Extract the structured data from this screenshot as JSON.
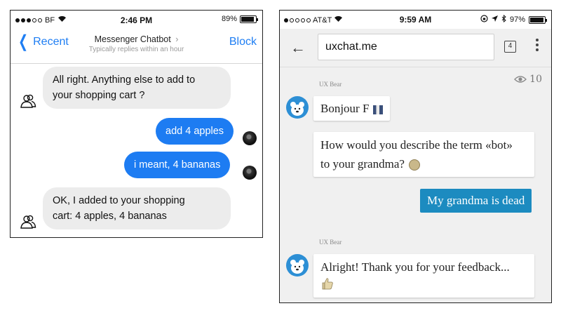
{
  "left": {
    "status_bar": {
      "carrier": "BF",
      "time": "2:46 PM",
      "battery": "89%"
    },
    "nav": {
      "back_label": "Recent",
      "title": "Messenger Chatbot",
      "subtitle": "Typically replies within an hour",
      "action_label": "Block"
    },
    "messages": [
      {
        "from": "bot",
        "text_line1": "All right. Anything else to add to",
        "text_line2": "your shopping cart ?"
      },
      {
        "from": "user",
        "text": "add 4 apples"
      },
      {
        "from": "user",
        "text": "i meant, 4 bananas"
      },
      {
        "from": "bot",
        "text_line1": "OK, I added to your shopping",
        "text_line2": "cart: 4 apples, 4 bananas"
      }
    ],
    "colors": {
      "accent": "#1d7cf2",
      "bot_bubble": "#ececec"
    }
  },
  "right": {
    "status_bar": {
      "carrier": "AT&T",
      "time": "9:59 AM",
      "battery": "97%"
    },
    "browser": {
      "url": "uxchat.me",
      "tab_count": "4"
    },
    "viewers_count": "10",
    "messages": [
      {
        "sender": "UX Bear",
        "text": "Bonjour F"
      },
      {
        "text_line1": "How would you describe the term «bot»",
        "text_line2": "to your grandma?"
      },
      {
        "from": "user",
        "text": "My grandma is dead"
      },
      {
        "sender": "UX Bear",
        "text_line1": "Alright! Thank you for your feedback..."
      }
    ],
    "colors": {
      "accent": "#1c8bc0",
      "avatar": "#2d8fd5"
    }
  }
}
